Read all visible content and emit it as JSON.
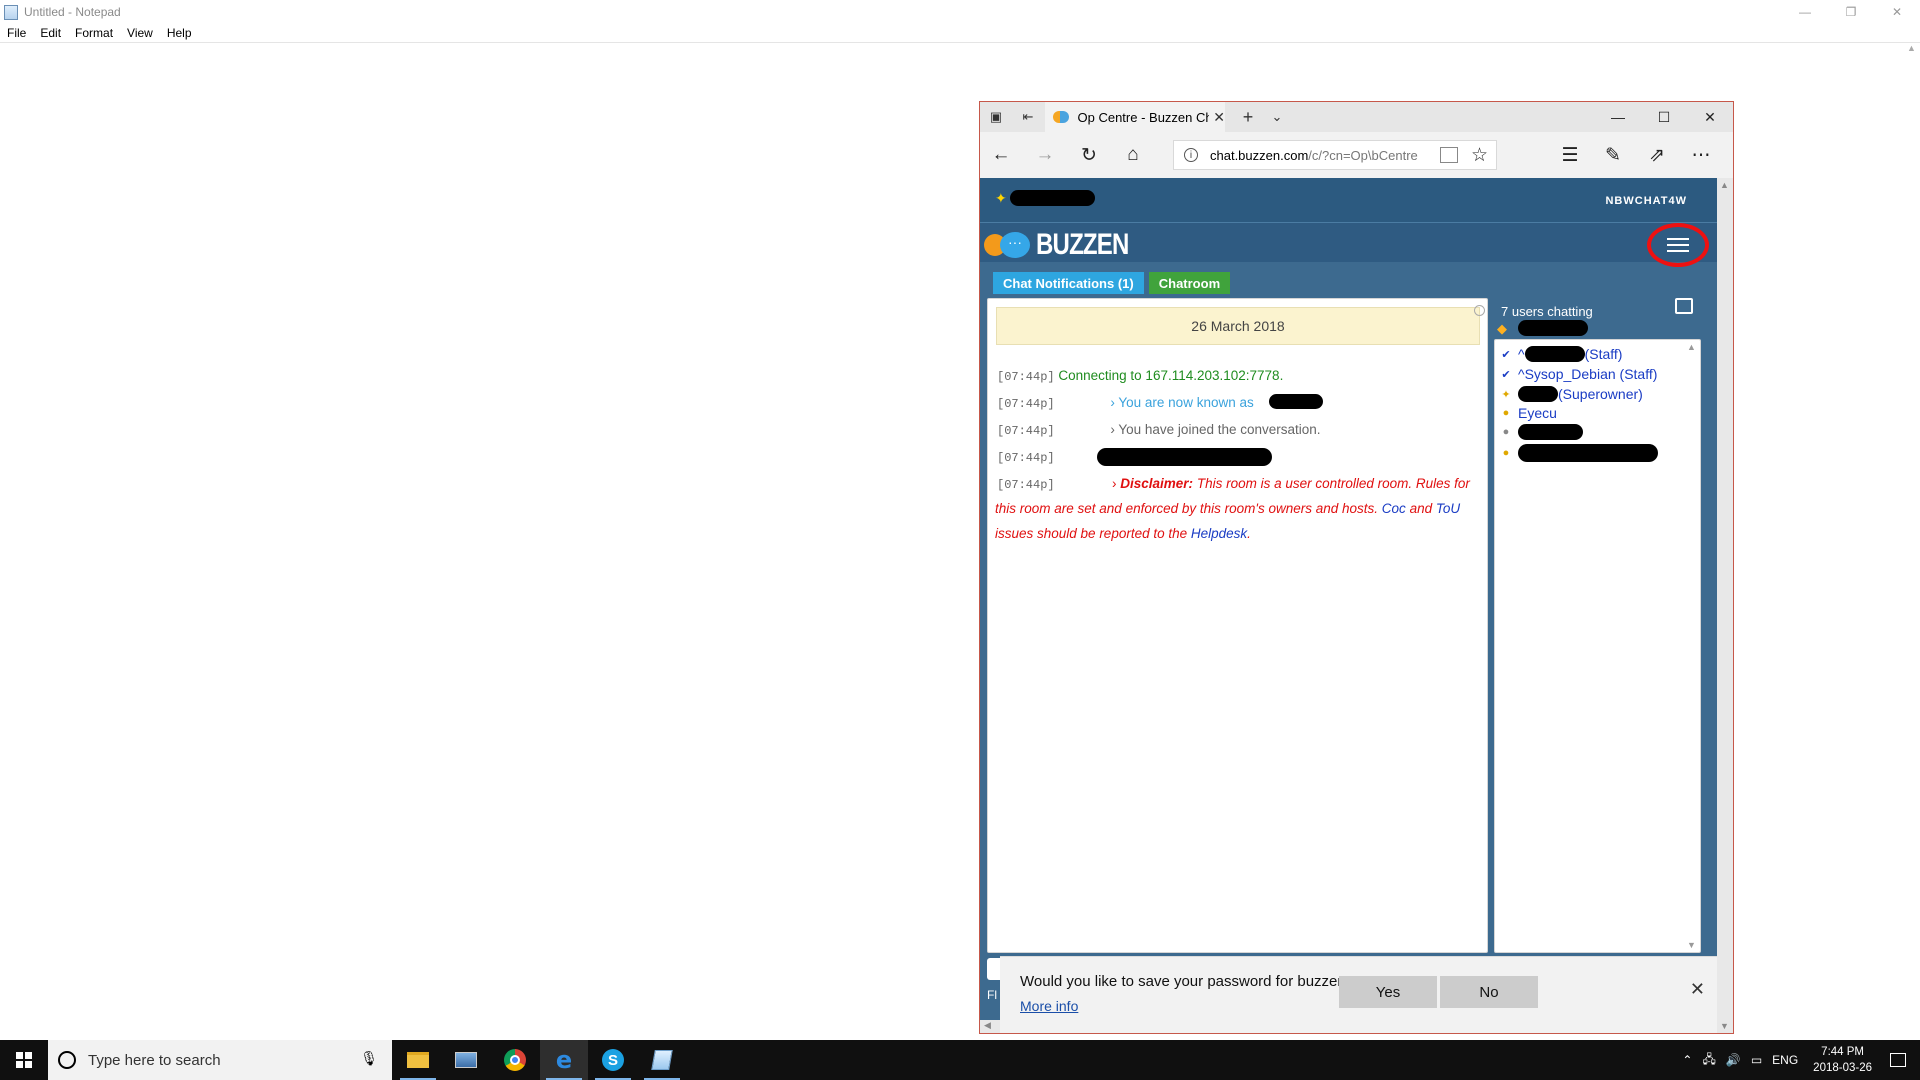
{
  "notepad": {
    "title": "Untitled - Notepad",
    "menu": [
      "File",
      "Edit",
      "Format",
      "View",
      "Help"
    ]
  },
  "browser": {
    "tab_title": "Op Centre - Buzzen Cha",
    "url_host": "chat.buzzen.com",
    "url_path": "/c/?cn=Op\\bCentre"
  },
  "buzzen": {
    "brand_small": "NBWCHAT4W",
    "logo_text": "BUZZEN",
    "tabs": [
      "Chat Notifications (1)",
      "Chatroom"
    ],
    "date": "26 March 2018",
    "messages": [
      {
        "time": "[07:44p]",
        "text": "Connecting to 167.114.203.102:7778."
      },
      {
        "time": "[07:44p]",
        "text": "› You are now known as"
      },
      {
        "time": "[07:44p]",
        "text": "› You have joined the conversation."
      },
      {
        "time": "[07:44p]",
        "text": ""
      },
      {
        "time": "[07:44p]",
        "text": ""
      }
    ],
    "disclaimer": {
      "label": "Disclaimer:",
      "body1": "This room is a user controlled room. Rules for this room are set and enforced by this room's owners and hosts.",
      "coc": "Coc",
      "and": "and",
      "tou": "ToU",
      "body2": "issues should be reported to the",
      "helpdesk": "Helpdesk",
      "end": "."
    },
    "users_count": "7 users chatting",
    "users": [
      {
        "name": "(Staff)",
        "prefix": "^"
      },
      {
        "name": "Sysop_Debian (Staff)",
        "prefix": "^"
      },
      {
        "name": "(Superowner)",
        "prefix": ""
      },
      {
        "name": "Eyecu",
        "prefix": ""
      },
      {
        "name": "",
        "prefix": ""
      },
      {
        "name": "",
        "prefix": ""
      }
    ]
  },
  "password_prompt": {
    "question": "Would you like to save your password for buzzen.com?",
    "more_info": "More info",
    "yes": "Yes",
    "no": "No",
    "partial_text": "Fl"
  },
  "taskbar": {
    "search_placeholder": "Type here to search",
    "language": "ENG",
    "time": "7:44 PM",
    "date": "2018-03-26"
  }
}
